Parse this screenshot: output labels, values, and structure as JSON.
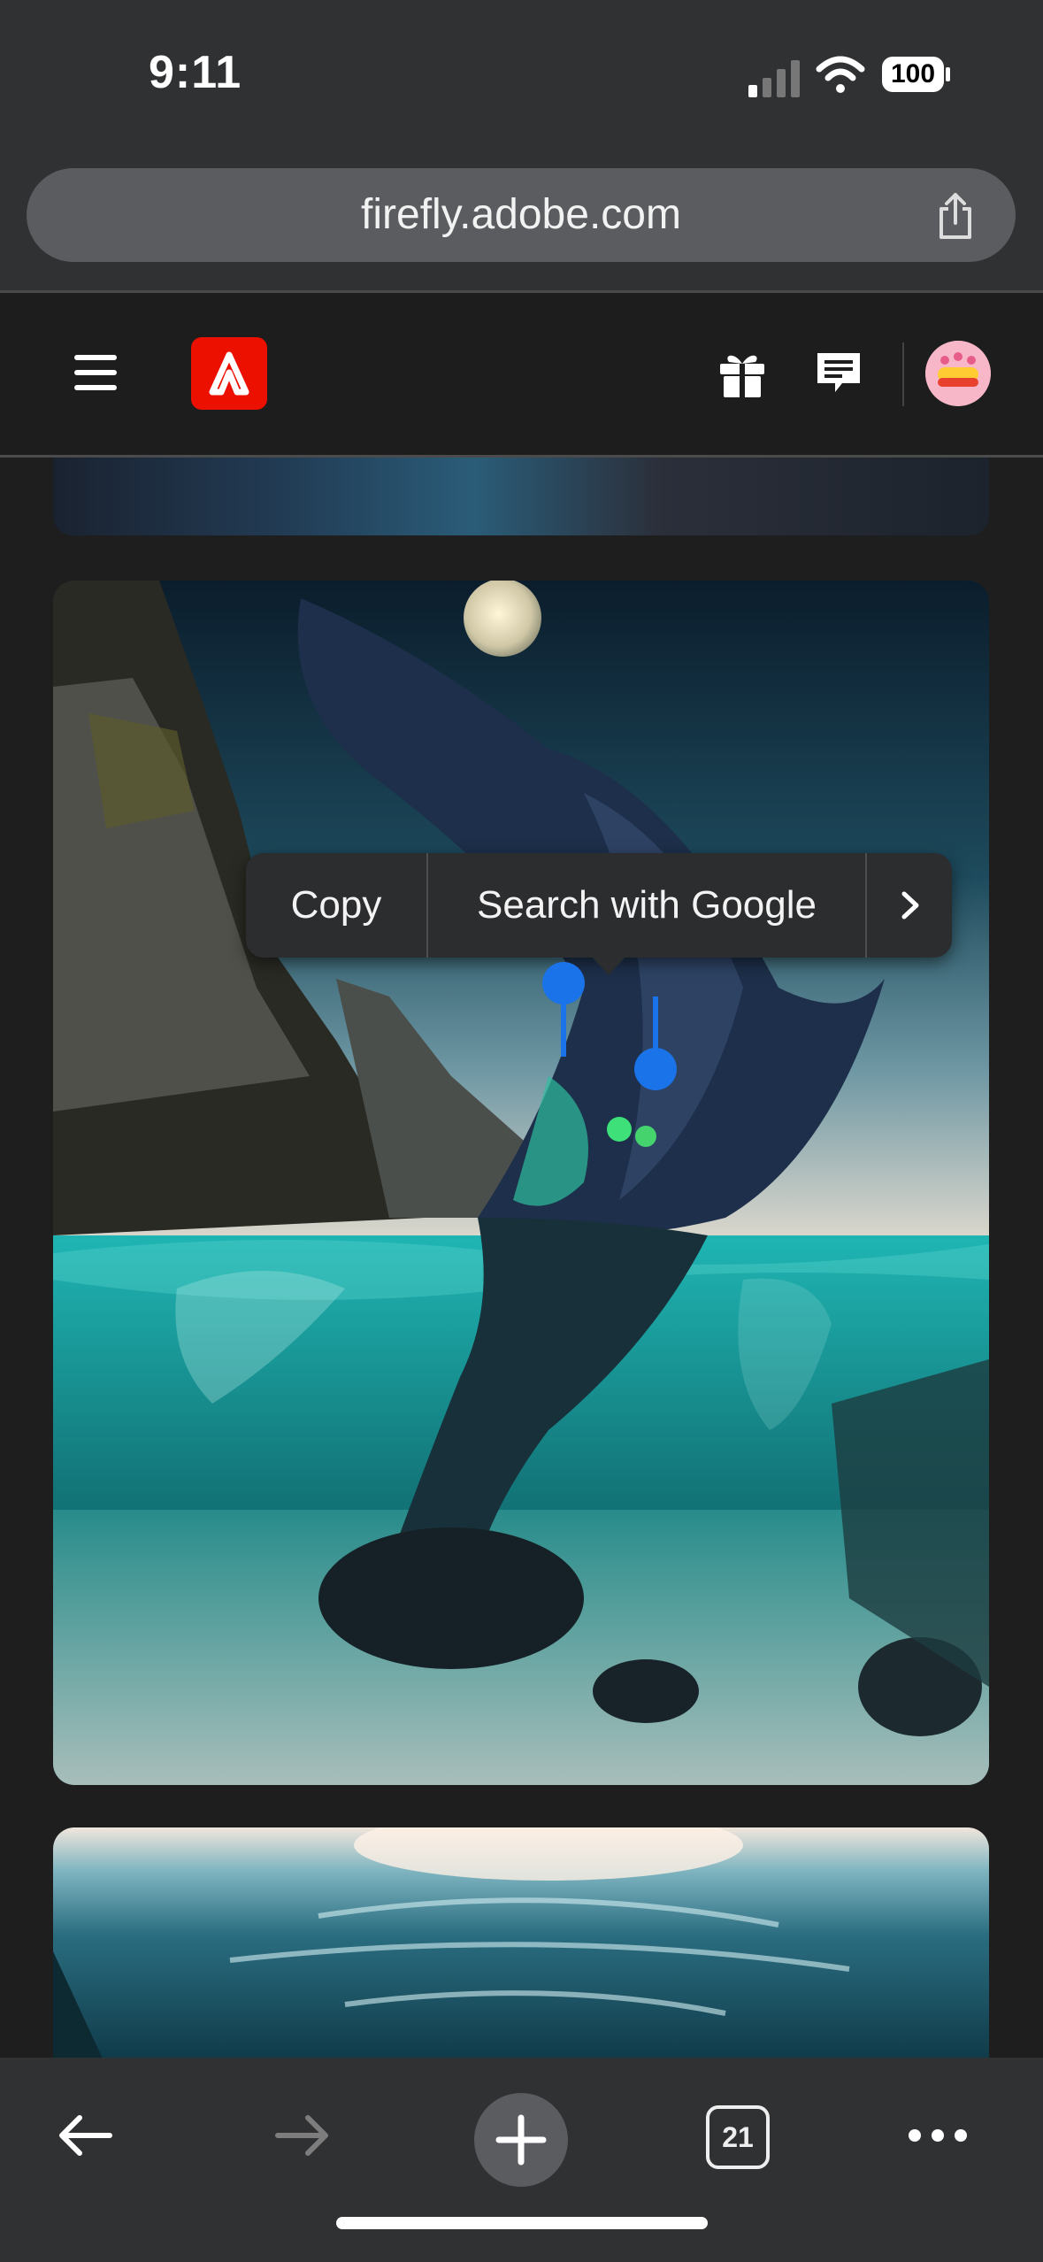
{
  "status": {
    "time": "9:11",
    "battery": "100"
  },
  "browser": {
    "url": "firefly.adobe.com",
    "tab_count": "21"
  },
  "context_menu": {
    "copy": "Copy",
    "search": "Search with Google"
  },
  "icons": {
    "signal": "cellular-signal-icon",
    "wifi": "wifi-icon",
    "battery": "battery-icon",
    "share": "share-icon",
    "menu": "hamburger-menu-icon",
    "logo": "adobe-logo",
    "gift": "gift-icon",
    "chat": "chat-icon",
    "avatar": "avatar",
    "back": "back-arrow-icon",
    "forward": "forward-arrow-icon",
    "new_tab": "plus-icon",
    "tabs": "tabs-icon",
    "more": "more-options-icon"
  },
  "colors": {
    "adobe_red": "#eb1000",
    "selection_blue": "#1a73e8",
    "toolbar_bg": "#303133"
  }
}
